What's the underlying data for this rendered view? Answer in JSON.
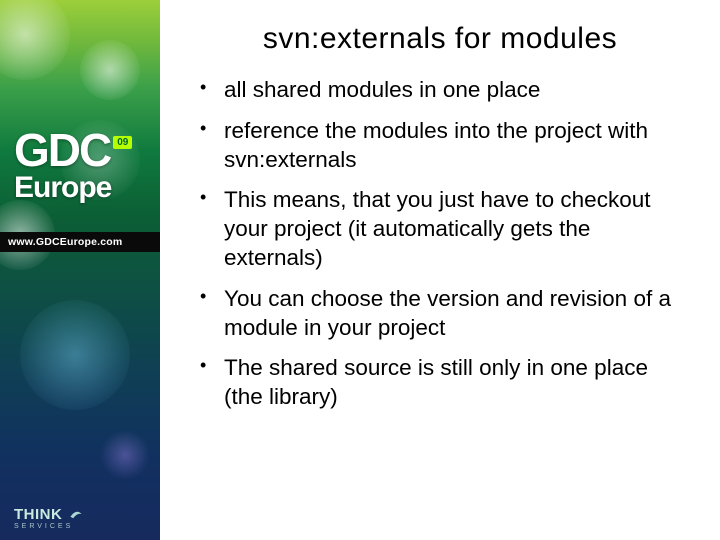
{
  "sidebar": {
    "logo_top": "GDC",
    "logo_badge": "09",
    "logo_bottom": "Europe",
    "url": "www.GDCEurope.com",
    "footer_brand": "THINK",
    "footer_sub": "SERVICES"
  },
  "slide": {
    "title": "svn:externals for modules",
    "bullets": [
      "all shared modules in one place",
      "reference the modules into the project with svn:externals",
      "This means, that you just have to checkout your project (it automatically gets the externals)",
      "You can choose the version and revision of a module in your project",
      "The shared source is still only in one place (the library)"
    ]
  }
}
